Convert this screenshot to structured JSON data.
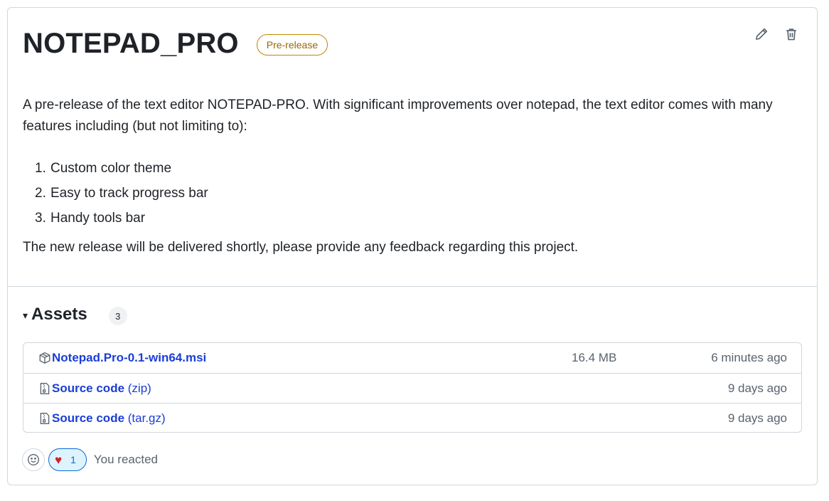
{
  "release": {
    "title": "NOTEPAD_PRO",
    "badge": "Pre-release",
    "colors": {
      "badge_border": "#bf8700",
      "link": "#1a3ed6",
      "accent": "#0969da",
      "heart": "#cf222e"
    }
  },
  "actions": {
    "edit_icon": "pencil-icon",
    "delete_icon": "trash-icon"
  },
  "description": {
    "intro": "A pre-release of the text editor NOTEPAD-PRO. With significant improvements over notepad, the text editor comes with many features including (but not limiting to):",
    "features": [
      {
        "num": "1.",
        "text": "Custom color theme"
      },
      {
        "num": "2.",
        "text": "Easy to track progress bar"
      },
      {
        "num": "3.",
        "text": "Handy tools bar"
      }
    ],
    "closing": "The new release will be delivered shortly, please provide any feedback regarding this project."
  },
  "assets": {
    "caret": "▾",
    "title": "Assets",
    "count": "3",
    "items": [
      {
        "icon": "package-icon",
        "name": "Notepad.Pro-0.1-win64.msi",
        "ext": "",
        "size": "16.4 MB",
        "time": "6 minutes ago"
      },
      {
        "icon": "file-zip-icon",
        "name": "Source code",
        "ext": " (zip)",
        "size": "",
        "time": "9 days ago"
      },
      {
        "icon": "file-zip-icon",
        "name": "Source code",
        "ext": " (tar.gz)",
        "size": "",
        "time": "9 days ago"
      }
    ]
  },
  "reactions": {
    "emoji_icon": "smiley-icon",
    "heart": "♥",
    "count": "1",
    "status": "You reacted"
  }
}
